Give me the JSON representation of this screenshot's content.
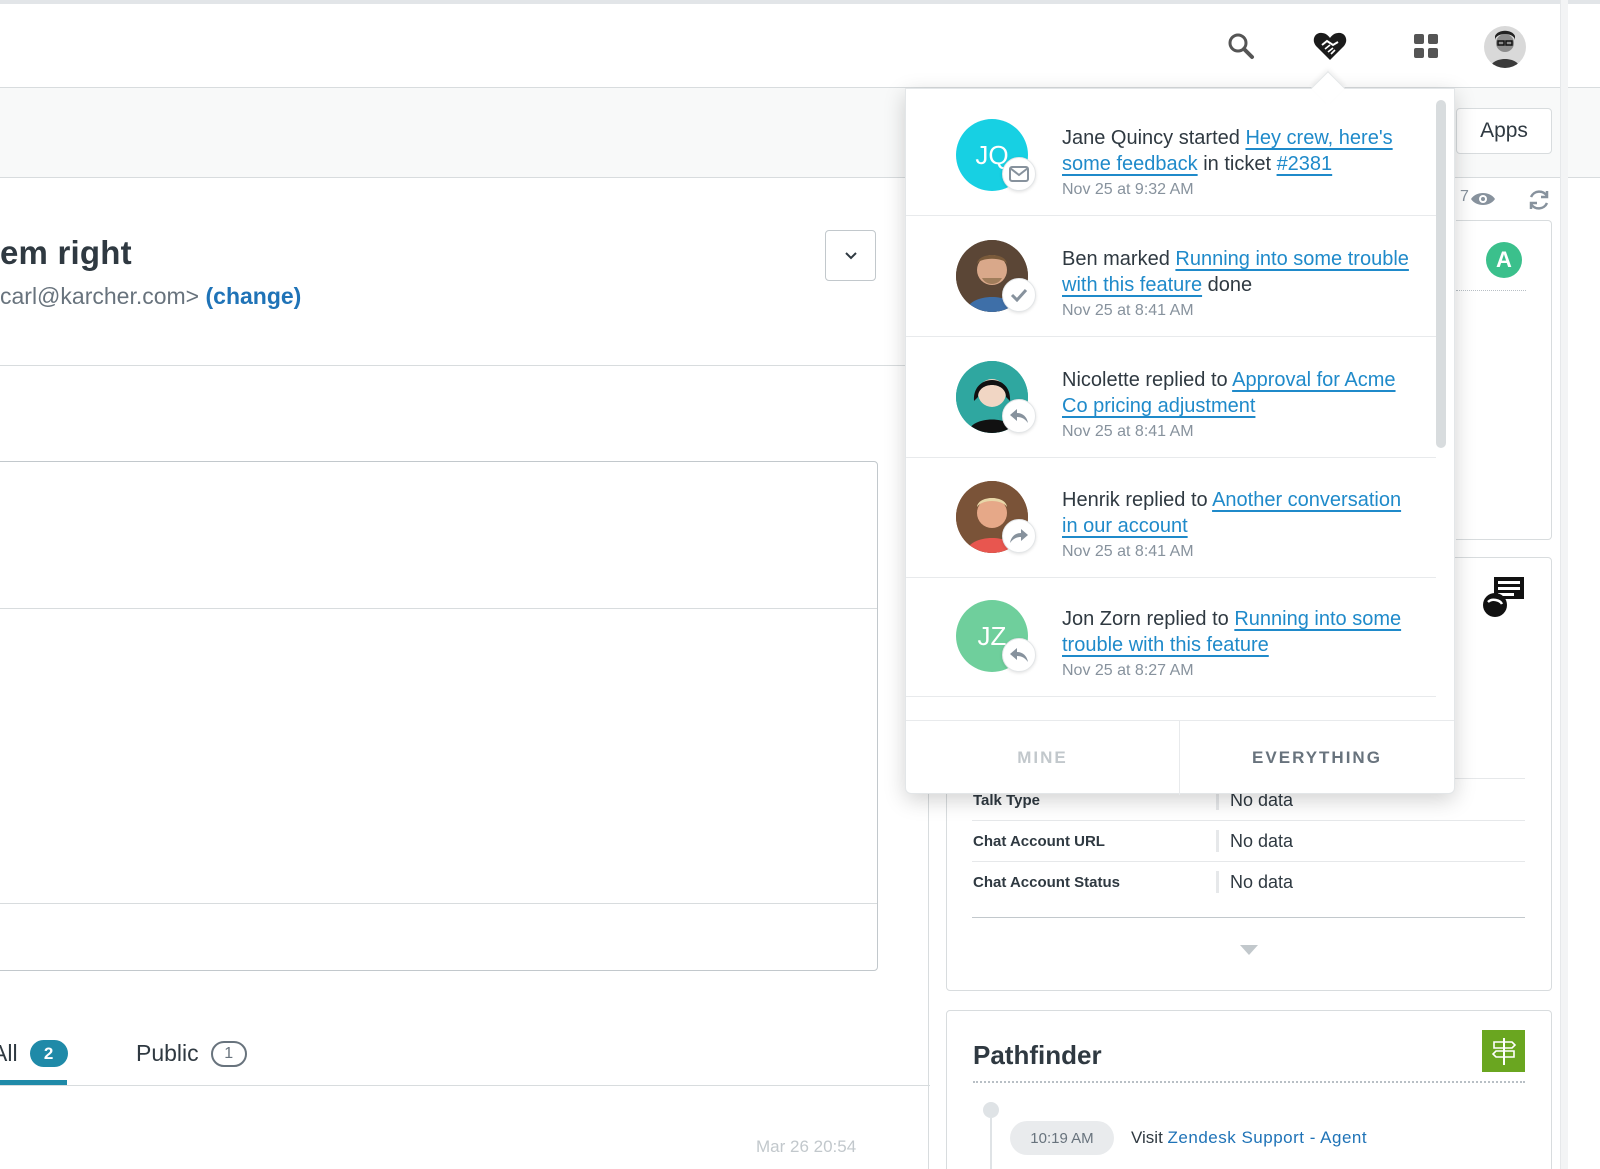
{
  "topbar": {
    "search_icon": "search-icon",
    "notifications_icon": "handshake-heart-icon",
    "apps_icon": "apps-grid-icon",
    "avatar": "user-avatar"
  },
  "subbar": {
    "apps_label": "Apps"
  },
  "ticket": {
    "title": "em right",
    "requester": "carl@karcher.com>",
    "change_label": "(change)"
  },
  "tabs": [
    {
      "label": "All",
      "count": "2"
    },
    {
      "label": "Public",
      "count": "1"
    }
  ],
  "faded_date": "Mar 26 20:54",
  "right_panel": {
    "viewer_count": "7",
    "app_badge_letter": "A",
    "fields": [
      {
        "label": "Talk Type",
        "value": "No data"
      },
      {
        "label": "Chat Account URL",
        "value": "No data"
      },
      {
        "label": "Chat Account Status",
        "value": "No data"
      }
    ],
    "pathfinder": {
      "title": "Pathfinder",
      "time": "10:19 AM",
      "visit_prefix": "Visit",
      "visit_link": "Zendesk Support - Agent"
    }
  },
  "notifications": {
    "items": [
      {
        "initials": "JQ",
        "avatar_color": "#17d0e3",
        "actor": "Jane Quincy started",
        "link": "Hey  crew, here's some feedback",
        "mid": " in ticket ",
        "link2": "#2381",
        "suffix": "",
        "time": "Nov 25 at 9:32 AM",
        "badge_icon": "mail-icon"
      },
      {
        "initials": "",
        "avatar_color": "#6b5a48",
        "actor": "Ben marked",
        "link": "Running into some trouble with this feature",
        "mid": "",
        "link2": "",
        "suffix": " done",
        "time": "Nov 25 at 8:41 AM",
        "badge_icon": "check-icon"
      },
      {
        "initials": "",
        "avatar_color": "#2fa7a0",
        "actor": "Nicolette replied to ",
        "link": "Approval for Acme Co pricing adjustment",
        "mid": "",
        "link2": "",
        "suffix": "",
        "time": "Nov 25 at 8:41 AM",
        "badge_icon": "reply-icon"
      },
      {
        "initials": "",
        "avatar_color": "#8a5a3c",
        "actor": "Henrik replied to",
        "link": "Another conversation in our account",
        "mid": "",
        "link2": "",
        "suffix": "",
        "time": "Nov 25 at 8:41 AM",
        "badge_icon": "forward-icon"
      },
      {
        "initials": "JZ",
        "avatar_color": "#6fcf9c",
        "actor": "Jon Zorn replied to",
        "link": "Running into some trouble with this feature",
        "mid": "",
        "link2": "",
        "suffix": "",
        "time": "Nov 25 at 8:27 AM",
        "badge_icon": "reply-icon"
      }
    ],
    "footer": {
      "mine": "MINE",
      "everything": "EVERYTHING"
    }
  }
}
